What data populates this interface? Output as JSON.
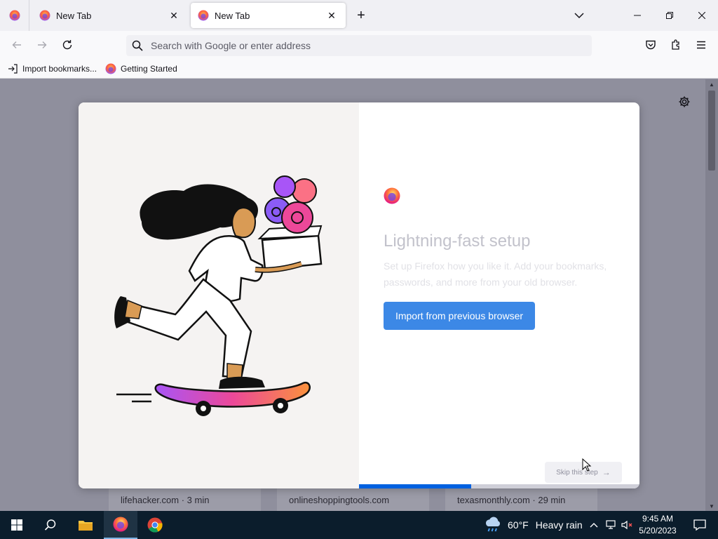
{
  "browser": {
    "tabs": [
      {
        "title": "New Tab",
        "icon": "firefox-icon"
      },
      {
        "title": "New Tab",
        "icon": "firefox-icon",
        "active": true
      }
    ],
    "new_tab_symbol": "+",
    "close_symbol": "✕",
    "address_placeholder": "Search with Google or enter address",
    "address_value": ""
  },
  "bookmarks": [
    {
      "label": "Import bookmarks...",
      "icon": "import-icon"
    },
    {
      "label": "Getting Started",
      "icon": "firefox-icon"
    }
  ],
  "onboarding": {
    "title": "Lightning-fast setup",
    "subtitle": "Set up Firefox how you like it. Add your bookmarks, passwords, and more from your old browser.",
    "primary_button": "Import from previous browser",
    "skip_button": "Skip this step",
    "skip_arrow": "→",
    "progress_fraction": 0.4
  },
  "top_sites": [
    {
      "label": "lifehacker.com · 3 min"
    },
    {
      "label": "onlineshoppingtools.com"
    },
    {
      "label": "texasmonthly.com · 29 min"
    }
  ],
  "taskbar": {
    "weather_temp": "60°F",
    "weather_text": "Heavy rain",
    "time": "9:45 AM",
    "date": "5/20/2023"
  },
  "colors": {
    "accent": "#0061e0",
    "import_button": "#3c88e6",
    "page_dim": "#8f8f9d",
    "taskbar": "#0b1d2c"
  }
}
